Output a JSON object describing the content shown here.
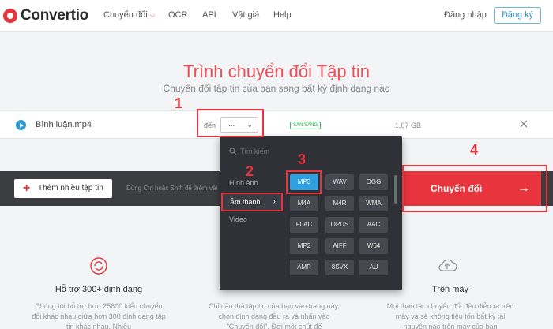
{
  "header": {
    "logo_text": "Convertio",
    "nav": [
      {
        "label": "Chuyển đổi",
        "has_dropdown": true
      },
      {
        "label": "OCR"
      },
      {
        "label": "API"
      },
      {
        "label": "Vật giá"
      },
      {
        "label": "Help"
      }
    ],
    "login_label": "Đăng nhập",
    "register_label": "Đăng ký"
  },
  "hero": {
    "title": "Trình chuyển đổi Tập tin",
    "subtitle": "Chuyển đổi tập tin của bạn sang bất kỳ định dạng nào"
  },
  "file": {
    "name": "Bình luận.mp4",
    "to_label": "đến",
    "selected_format": "...",
    "status": "SẴN SÀNG",
    "size": "1.07 GB"
  },
  "actions": {
    "add_label": "Thêm nhiều tập tin",
    "hint": "Dùng Ctrl hoặc Shift để thêm vài",
    "convert_label": "Chuyển đổi"
  },
  "dropdown": {
    "search_placeholder": "Tìm kiếm",
    "categories": [
      "Hình ảnh",
      "Âm thanh",
      "Video"
    ],
    "active_category": "Âm thanh",
    "formats": [
      "MP3",
      "WAV",
      "OGG",
      "M4A",
      "M4R",
      "WMA",
      "FLAC",
      "OPUS",
      "AAC",
      "MP2",
      "AIFF",
      "W64",
      "AMR",
      "8SVX",
      "AU"
    ],
    "selected_format": "MP3"
  },
  "features": [
    {
      "title": "Hỗ trợ 300+ định dạng",
      "desc": "Chúng tôi hỗ trợ hơn 25600 kiểu chuyển đổi khác nhau giữa hơn 300 định dạng tập tin khác nhau. Nhiều"
    },
    {
      "title": "",
      "desc": "Chỉ cần thả tập tin của bạn vào trang này, chọn định dạng đầu ra và nhấn vào \"Chuyển đổi\". Đợi một chút để"
    },
    {
      "title": "Trên mây",
      "desc": "Mọi thao tác chuyển đổi đều diễn ra trên mây và sẽ không tiêu tốn bất kỳ tài nguyên nào trên máy của bạn"
    }
  ],
  "annotations": [
    "1",
    "2",
    "3",
    "4"
  ],
  "colors": {
    "accent": "#e8343c",
    "selected": "#2fa0e0",
    "dropdown_bg": "#2f3136",
    "bar_bg": "#3b3d41"
  }
}
